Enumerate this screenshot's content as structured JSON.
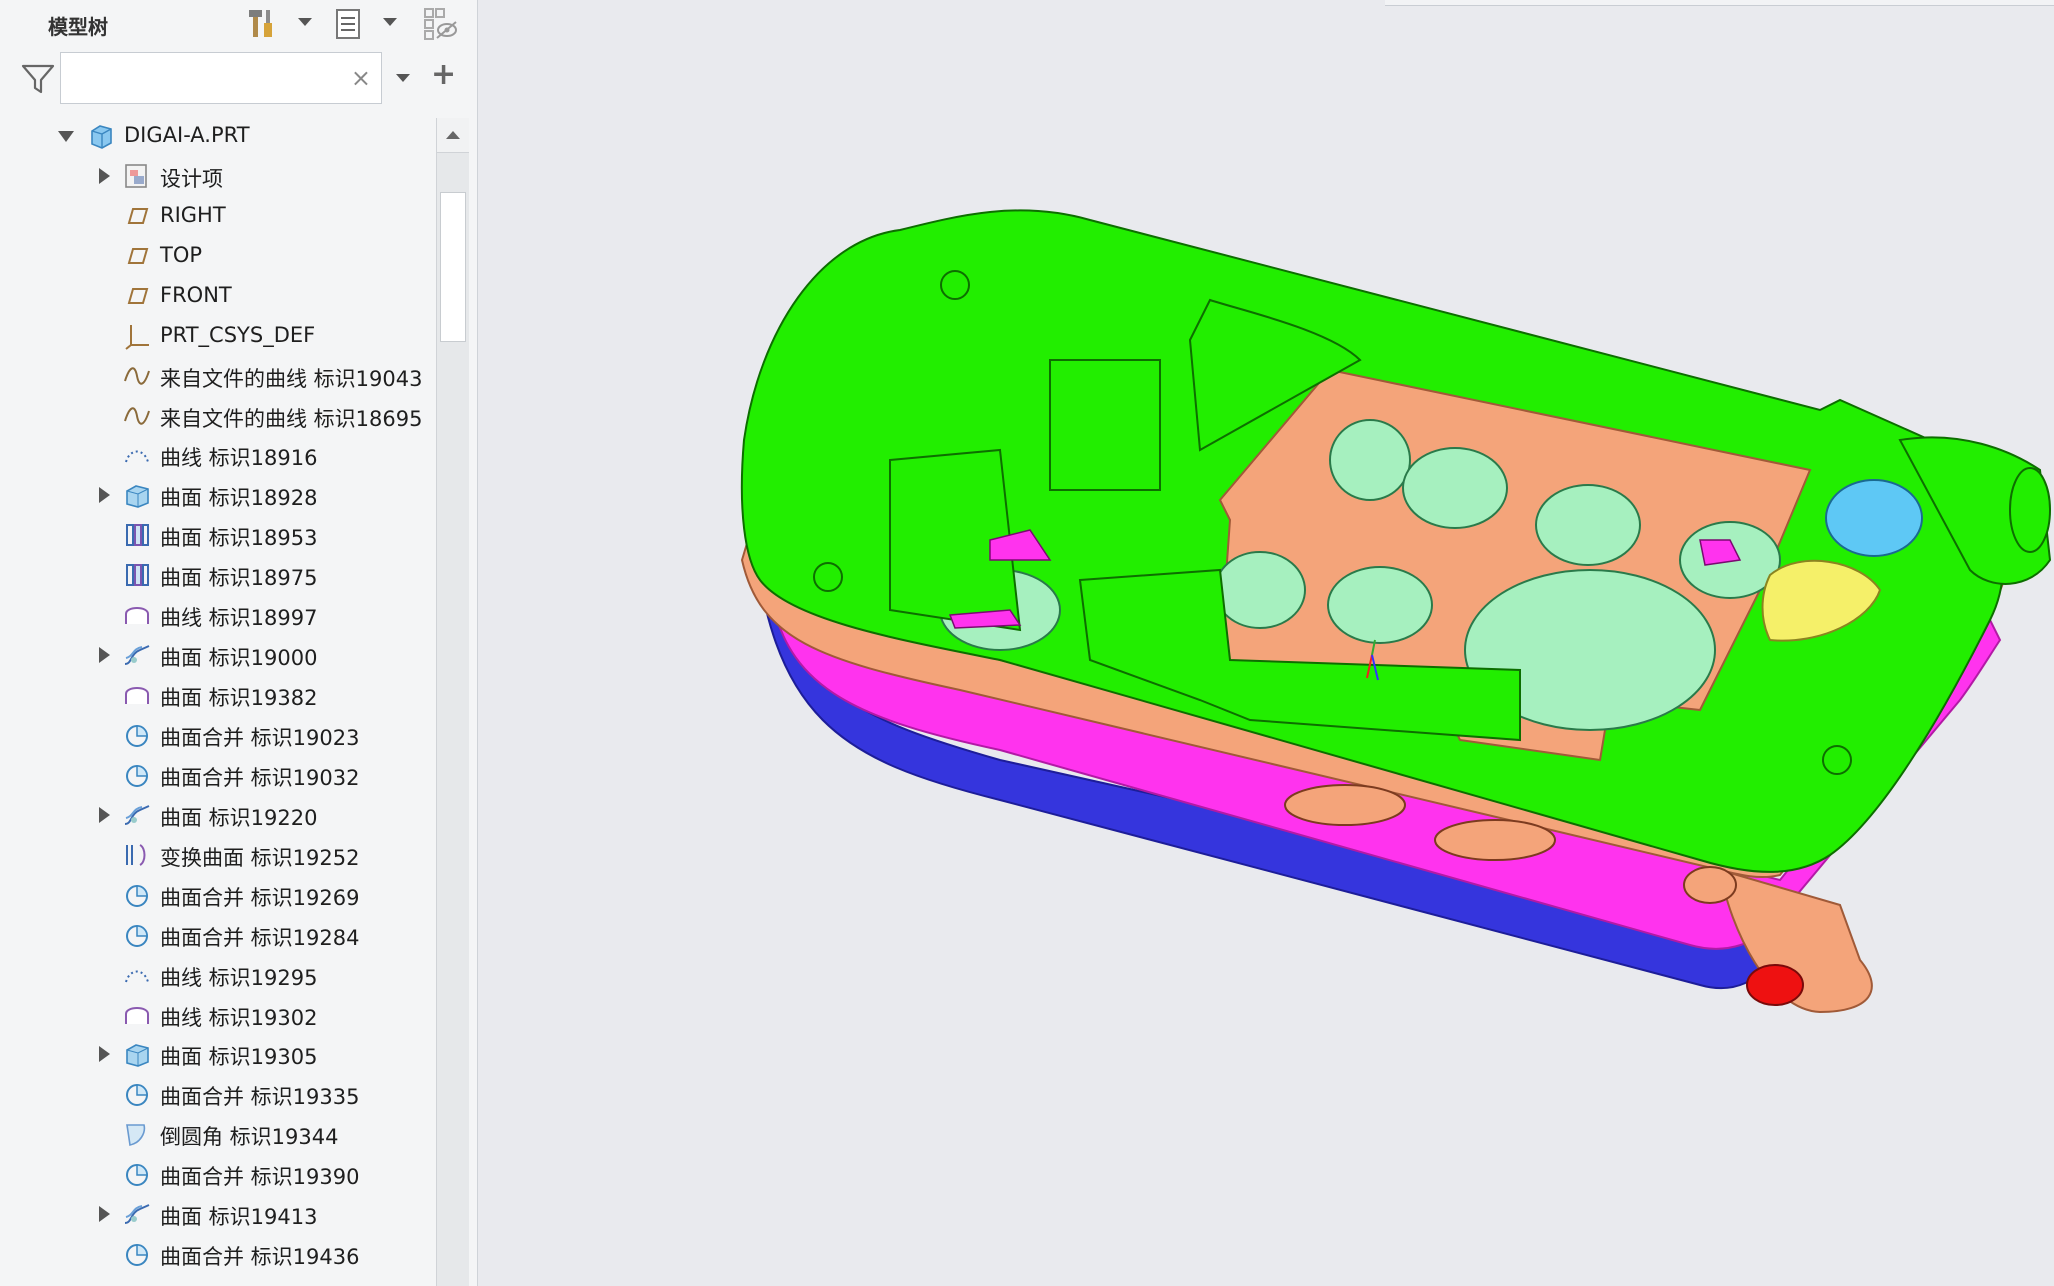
{
  "panel": {
    "title": "模型树",
    "search": {
      "value": "",
      "clear_symbol": "×",
      "add_symbol": "+"
    }
  },
  "tree": {
    "root": {
      "label": "DIGAI-A.PRT",
      "icon": "part-icon",
      "expanded": true
    },
    "items": [
      {
        "label": "设计项",
        "icon": "design-items-icon",
        "expandable": true
      },
      {
        "label": "RIGHT",
        "icon": "datum-plane-icon",
        "expandable": false
      },
      {
        "label": "TOP",
        "icon": "datum-plane-icon",
        "expandable": false
      },
      {
        "label": "FRONT",
        "icon": "datum-plane-icon",
        "expandable": false
      },
      {
        "label": "PRT_CSYS_DEF",
        "icon": "coordinate-system-icon",
        "expandable": false
      },
      {
        "label": "来自文件的曲线 标识19043",
        "icon": "curve-from-file-icon",
        "expandable": false
      },
      {
        "label": "来自文件的曲线 标识18695",
        "icon": "curve-from-file-icon",
        "expandable": false
      },
      {
        "label": "曲线 标识18916",
        "icon": "curve-dotted-icon",
        "expandable": false
      },
      {
        "label": "曲面 标识18928",
        "icon": "surface-solid-icon",
        "expandable": true
      },
      {
        "label": "曲面 标识18953",
        "icon": "surface-boundary-icon",
        "expandable": false
      },
      {
        "label": "曲面 标识18975",
        "icon": "surface-boundary-icon",
        "expandable": false
      },
      {
        "label": "曲线 标识18997",
        "icon": "curve-intersect-icon",
        "expandable": false
      },
      {
        "label": "曲面 标识19000",
        "icon": "surface-sweep-icon",
        "expandable": true
      },
      {
        "label": "曲面 标识19382",
        "icon": "curve-intersect-icon",
        "expandable": false
      },
      {
        "label": "曲面合并 标识19023",
        "icon": "surface-merge-icon",
        "expandable": false
      },
      {
        "label": "曲面合并 标识19032",
        "icon": "surface-merge-icon",
        "expandable": false
      },
      {
        "label": "曲面 标识19220",
        "icon": "surface-sweep-icon",
        "expandable": true
      },
      {
        "label": "变换曲面 标识19252",
        "icon": "transform-surface-icon",
        "expandable": false
      },
      {
        "label": "曲面合并 标识19269",
        "icon": "surface-merge-icon",
        "expandable": false
      },
      {
        "label": "曲面合并 标识19284",
        "icon": "surface-merge-icon",
        "expandable": false
      },
      {
        "label": "曲线 标识19295",
        "icon": "curve-dotted-icon",
        "expandable": false
      },
      {
        "label": "曲线 标识19302",
        "icon": "curve-intersect-icon",
        "expandable": false
      },
      {
        "label": "曲面 标识19305",
        "icon": "surface-solid-icon",
        "expandable": true
      },
      {
        "label": "曲面合并 标识19335",
        "icon": "surface-merge-icon",
        "expandable": false
      },
      {
        "label": "倒圆角 标识19344",
        "icon": "round-icon",
        "expandable": false
      },
      {
        "label": "曲面合并 标识19390",
        "icon": "surface-merge-icon",
        "expandable": false
      },
      {
        "label": "曲面 标识19413",
        "icon": "surface-sweep-icon",
        "expandable": true
      },
      {
        "label": "曲面合并 标识19436",
        "icon": "surface-merge-icon",
        "expandable": false
      }
    ]
  },
  "model": {
    "colors": {
      "green": "#22ee00",
      "salmon": "#f4a47a",
      "mint": "#a6f0bf",
      "magenta": "#ff33ee",
      "blue": "#3535dd",
      "cyan": "#5ec8f5",
      "yellow": "#f5f069",
      "red": "#ee1111"
    }
  }
}
